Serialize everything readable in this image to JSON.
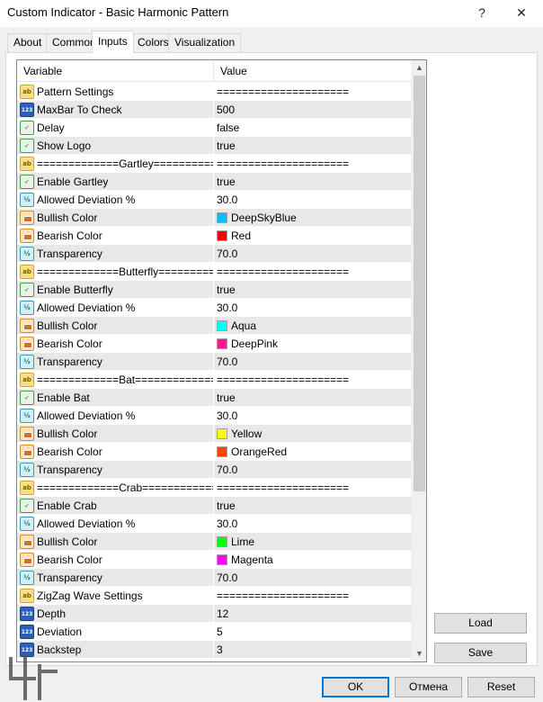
{
  "window": {
    "title": "Custom Indicator - Basic Harmonic Pattern",
    "help_glyph": "?",
    "close_glyph": "✕"
  },
  "tabs": [
    {
      "label": "About"
    },
    {
      "label": "Common"
    },
    {
      "label": "Inputs",
      "active": true
    },
    {
      "label": "Colors"
    },
    {
      "label": "Visualization"
    }
  ],
  "grid": {
    "columns": [
      "Variable",
      "Value"
    ],
    "rows": [
      {
        "type": "ab",
        "variable": "Pattern Settings",
        "value": "====================="
      },
      {
        "type": "n123",
        "variable": "MaxBar To Check",
        "value": "500"
      },
      {
        "type": "bool",
        "variable": "Delay",
        "value": "false"
      },
      {
        "type": "bool",
        "variable": "Show Logo",
        "value": "true"
      },
      {
        "type": "ab",
        "variable": "=============Gartley=============",
        "value": "====================="
      },
      {
        "type": "bool",
        "variable": "Enable Gartley",
        "value": "true"
      },
      {
        "type": "dbl",
        "variable": "Allowed Deviation %",
        "value": "30.0"
      },
      {
        "type": "clr",
        "variable": "Bullish Color",
        "value": "DeepSkyBlue",
        "swatch": "#00bfff"
      },
      {
        "type": "clr",
        "variable": "Bearish Color",
        "value": "Red",
        "swatch": "#ff0000"
      },
      {
        "type": "dbl",
        "variable": "Transparency",
        "value": "70.0"
      },
      {
        "type": "ab",
        "variable": "=============Butterfly==========...",
        "value": "====================="
      },
      {
        "type": "bool",
        "variable": "Enable Butterfly",
        "value": "true"
      },
      {
        "type": "dbl",
        "variable": "Allowed Deviation %",
        "value": "30.0"
      },
      {
        "type": "clr",
        "variable": "Bullish Color",
        "value": "Aqua",
        "swatch": "#00ffff"
      },
      {
        "type": "clr",
        "variable": "Bearish Color",
        "value": "DeepPink",
        "swatch": "#ff1493"
      },
      {
        "type": "dbl",
        "variable": "Transparency",
        "value": "70.0"
      },
      {
        "type": "ab",
        "variable": "=============Bat=============",
        "value": "====================="
      },
      {
        "type": "bool",
        "variable": "Enable Bat",
        "value": "true"
      },
      {
        "type": "dbl",
        "variable": "Allowed Deviation %",
        "value": "30.0"
      },
      {
        "type": "clr",
        "variable": "Bullish Color",
        "value": "Yellow",
        "swatch": "#ffff00"
      },
      {
        "type": "clr",
        "variable": "Bearish Color",
        "value": "OrangeRed",
        "swatch": "#ff4500"
      },
      {
        "type": "dbl",
        "variable": "Transparency",
        "value": "70.0"
      },
      {
        "type": "ab",
        "variable": "=============Crab=============",
        "value": "====================="
      },
      {
        "type": "bool",
        "variable": "Enable Crab",
        "value": "true"
      },
      {
        "type": "dbl",
        "variable": "Allowed Deviation %",
        "value": "30.0"
      },
      {
        "type": "clr",
        "variable": "Bullish Color",
        "value": "Lime",
        "swatch": "#00ff00"
      },
      {
        "type": "clr",
        "variable": "Bearish Color",
        "value": "Magenta",
        "swatch": "#ff00ff"
      },
      {
        "type": "dbl",
        "variable": "Transparency",
        "value": "70.0"
      },
      {
        "type": "ab",
        "variable": "ZigZag Wave Settings",
        "value": "====================="
      },
      {
        "type": "n123",
        "variable": "Depth",
        "value": "12"
      },
      {
        "type": "n123",
        "variable": "Deviation",
        "value": "5"
      },
      {
        "type": "n123",
        "variable": "Backstep",
        "value": "3"
      }
    ]
  },
  "icon_glyphs": {
    "ab": "ab",
    "n123": "123",
    "bool": "✓",
    "dbl": "½",
    "clr": ""
  },
  "buttons": {
    "load": "Load",
    "save": "Save",
    "ok": "OK",
    "cancel": "Отмена",
    "reset": "Reset"
  }
}
